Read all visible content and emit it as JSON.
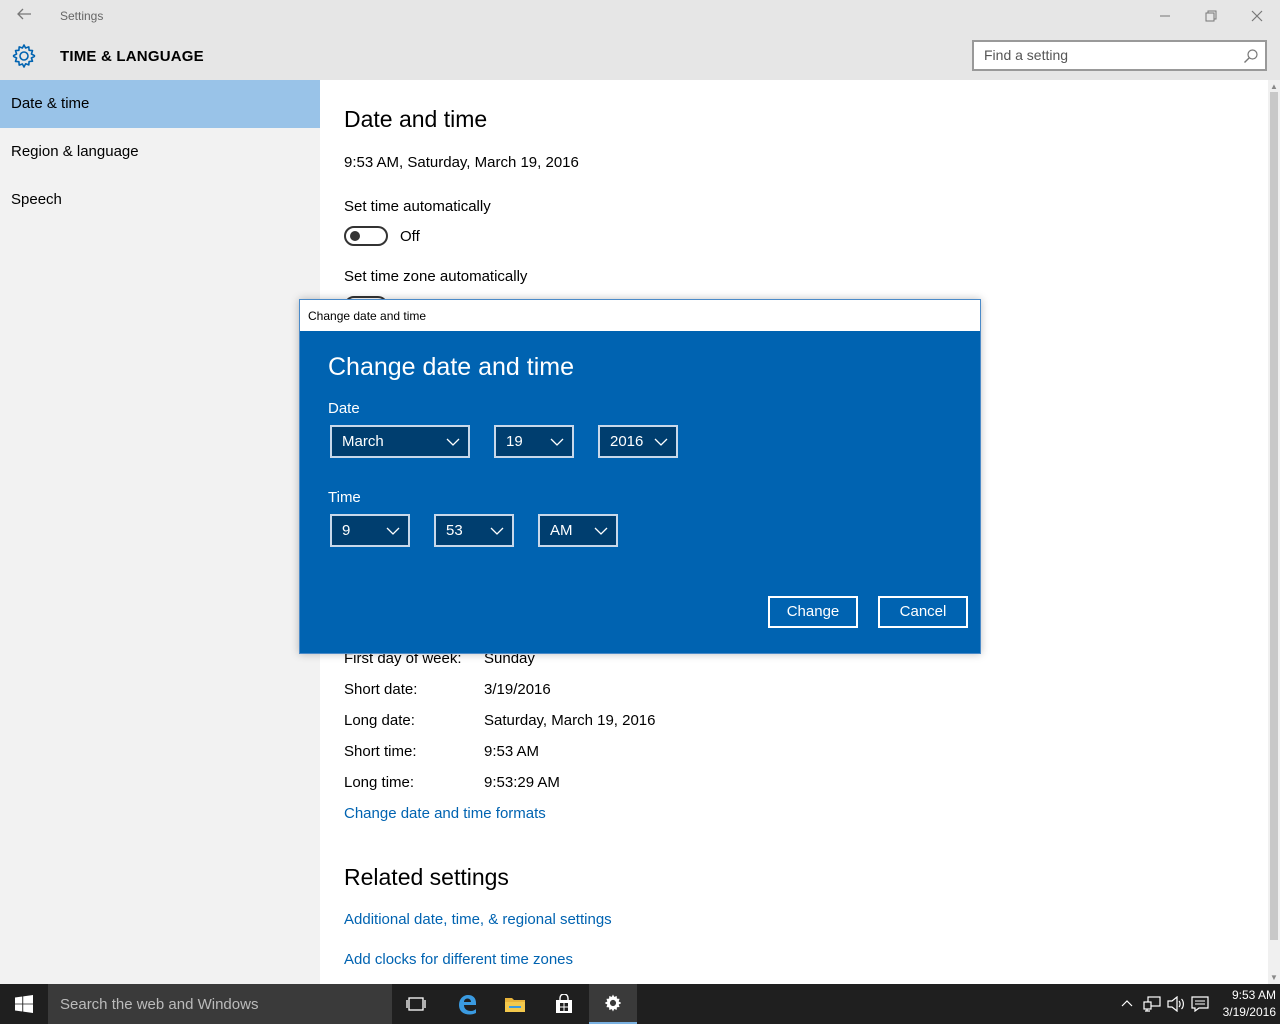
{
  "window": {
    "title": "Settings",
    "controls": {
      "minimize": "—",
      "restore": "❐",
      "close": "✕"
    }
  },
  "header": {
    "app_title": "TIME & LANGUAGE",
    "search_placeholder": "Find a setting"
  },
  "sidebar": {
    "items": [
      {
        "label": "Date & time",
        "active": true
      },
      {
        "label": "Region & language",
        "active": false
      },
      {
        "label": "Speech",
        "active": false
      }
    ]
  },
  "main": {
    "title": "Date and time",
    "current_datetime": "9:53 AM, Saturday, March 19, 2016",
    "set_time_auto_label": "Set time automatically",
    "set_time_auto_state": "Off",
    "set_tz_auto_label": "Set time zone automatically",
    "formats": [
      {
        "label": "First day of week:",
        "value": "Sunday"
      },
      {
        "label": "Short date:",
        "value": "3/19/2016"
      },
      {
        "label": "Long date:",
        "value": "Saturday, March 19, 2016"
      },
      {
        "label": "Short time:",
        "value": "9:53 AM"
      },
      {
        "label": "Long time:",
        "value": "9:53:29 AM"
      }
    ],
    "change_formats_link": "Change date and time formats",
    "related_title": "Related settings",
    "related_links": [
      "Additional date, time, & regional settings",
      "Add clocks for different time zones"
    ]
  },
  "dialog": {
    "window_title": "Change date and time",
    "heading": "Change date and time",
    "date_label": "Date",
    "month": "March",
    "day": "19",
    "year": "2016",
    "time_label": "Time",
    "hour": "9",
    "minute": "53",
    "ampm": "AM",
    "change_button": "Change",
    "cancel_button": "Cancel"
  },
  "taskbar": {
    "search_placeholder": "Search the web and Windows",
    "clock_time": "9:53 AM",
    "clock_date": "3/19/2016"
  },
  "colors": {
    "accent": "#0063b1",
    "sidebar_active": "#99c3e8",
    "link": "#0063b1",
    "taskbar": "#1f1f1f"
  }
}
